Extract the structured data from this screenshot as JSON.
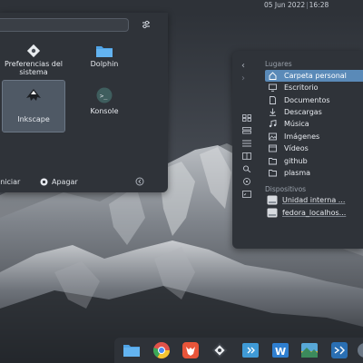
{
  "top_panel": {
    "date": "05 Jun 2022",
    "time": "16:28"
  },
  "launcher": {
    "search": {
      "value": "",
      "placeholder": ""
    },
    "apps": [
      {
        "label": "Preferencias del sistema",
        "icon": "system-settings-icon",
        "selected": false
      },
      {
        "label": "Dolphin",
        "icon": "folder-icon",
        "selected": false
      },
      {
        "label": "Inkscape",
        "icon": "inkscape-icon",
        "selected": true
      },
      {
        "label": "Konsole",
        "icon": "terminal-icon",
        "selected": false
      }
    ],
    "footer": {
      "restart_label": "iniciar",
      "shutdown_label": "Apagar"
    }
  },
  "dolphin": {
    "places_title": "Lugares",
    "places": [
      {
        "label": "Carpeta personal",
        "icon": "home-icon",
        "active": true
      },
      {
        "label": "Escritorio",
        "icon": "desktop-icon",
        "active": false
      },
      {
        "label": "Documentos",
        "icon": "documents-icon",
        "active": false
      },
      {
        "label": "Descargas",
        "icon": "download-icon",
        "active": false
      },
      {
        "label": "Música",
        "icon": "music-icon",
        "active": false
      },
      {
        "label": "Imágenes",
        "icon": "images-icon",
        "active": false
      },
      {
        "label": "Vídeos",
        "icon": "videos-icon",
        "active": false
      },
      {
        "label": "github",
        "icon": "folder-icon",
        "active": false
      },
      {
        "label": "plasma",
        "icon": "folder-icon",
        "active": false
      }
    ],
    "devices_title": "Dispositivos",
    "devices": [
      {
        "label": "Unidad interna ...",
        "icon": "drive-icon"
      },
      {
        "label": "fedora_localhos...",
        "icon": "drive-icon"
      }
    ]
  },
  "dock": {
    "items": [
      {
        "name": "folder-icon"
      },
      {
        "name": "chrome-icon"
      },
      {
        "name": "firefox-icon"
      },
      {
        "name": "system-settings-icon"
      },
      {
        "name": "kde-connect-icon"
      },
      {
        "name": "libreoffice-writer-icon"
      },
      {
        "name": "image-viewer-icon"
      },
      {
        "name": "vscode-icon"
      },
      {
        "name": "app-icon"
      }
    ]
  },
  "colors": {
    "panel": "#2f3339",
    "accent": "#5a8ab8",
    "selected_app": "#4f5965",
    "folder": "#4fa3e6"
  }
}
